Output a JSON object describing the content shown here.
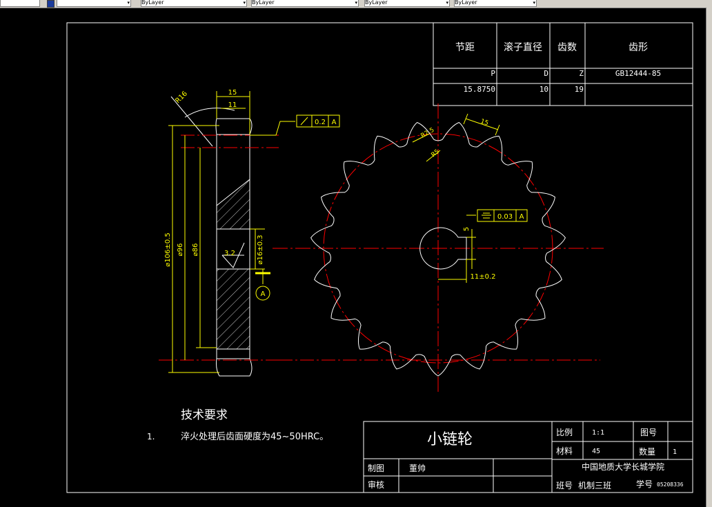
{
  "toolbar": {
    "layer_value": "",
    "color": "ByLayer",
    "linetype": "ByLayer",
    "lineweight": "ByLayer",
    "plotstyle": "ByLayer"
  },
  "param_table": {
    "headers": [
      "节距",
      "滚子直径",
      "齿数",
      "齿形"
    ],
    "symbols": [
      "P",
      "D",
      "Z",
      "GB12444-85"
    ],
    "values": [
      "15.8750",
      "10",
      "19",
      ""
    ]
  },
  "dims": {
    "width_15": "15",
    "width_11": "11",
    "radius_r16": "R16",
    "dia_106": "⌀106±0.5",
    "dia_96": "⌀96",
    "dia_86": "⌀86",
    "bore_dia": "⌀16±0.3",
    "roughness": "3.2",
    "datum_a": "A",
    "flatness_val": "0.2",
    "flatness_ref": "A",
    "sym_val": "0.03",
    "sym_ref": "A",
    "key_depth": "5",
    "key_width": "11±0.2",
    "tooth_r25": "R2.5",
    "tooth_r5": "R5",
    "tooth_15": "15"
  },
  "tech": {
    "title": "技术要求",
    "item_no": "1.",
    "item_text": "淬火处理后齿面硬度为45~50HRC。"
  },
  "title_block": {
    "part_name": "小链轮",
    "scale_label": "比例",
    "scale_value": "1:1",
    "drawing_no_label": "图号",
    "material_label": "材料",
    "material_value": "45",
    "qty_label": "数量",
    "qty_value": "1",
    "drawn_label": "制图",
    "drawn_value": "董帅",
    "check_label": "审核",
    "school": "中国地质大学长城学院",
    "class_label": "班号",
    "class_value": "机制三班",
    "student_label": "学号",
    "student_value": "05208336"
  },
  "colors": {
    "background": "#000000",
    "lines": "#ffffff",
    "dims": "#ffff00",
    "center": "#ff0000"
  }
}
